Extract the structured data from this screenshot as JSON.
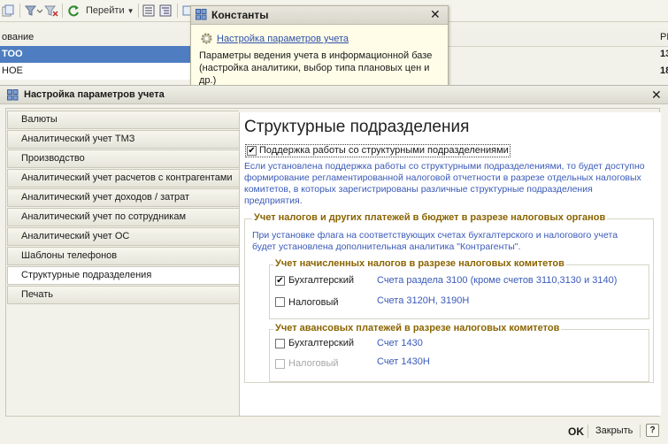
{
  "background": {
    "toolbar": {
      "goto_label": "Перейти"
    },
    "header": {
      "col_name": "ование",
      "col_right": "РЕ"
    },
    "rows": [
      {
        "name": "ТОО",
        "right": "13"
      },
      {
        "name": "НОЕ",
        "right": "18"
      }
    ]
  },
  "popup": {
    "title": "Константы",
    "link": "Настройка параметров учета",
    "description": "Параметры ведения учета в информационной базе (настройка аналитики, выбор типа плановых цен и др.)"
  },
  "window": {
    "title": "Настройка параметров учета",
    "tabs": [
      {
        "label": "Валюты"
      },
      {
        "label": "Аналитический учет ТМЗ"
      },
      {
        "label": "Производство"
      },
      {
        "label": "Аналитический учет расчетов с контрагентами"
      },
      {
        "label": "Аналитический учет доходов / затрат"
      },
      {
        "label": "Аналитический учет по сотрудникам"
      },
      {
        "label": "Аналитический учет ОС"
      },
      {
        "label": "Шаблоны телефонов"
      },
      {
        "label": "Структурные подразделения"
      },
      {
        "label": "Печать"
      }
    ],
    "content": {
      "heading": "Структурные подразделения",
      "support_checkbox": {
        "label": "Поддержка работы со структурными подразделениями",
        "checked": true
      },
      "support_description": "Если установлена поддержка работы со структурными подразделениями, то будет доступно формирование регламентированной налоговой отчетности в разрезе отдельных налоговых комитетов, в которых зарегистрированы различные структурные подразделения предприятия.",
      "budget_group": {
        "title": "Учет налогов и других платежей в бюджет в разрезе налоговых органов",
        "description": "При установке флага на соответствующих счетах бухгалтерского и налогового учета будет установлена дополнительная аналитика \"Контрагенты\".",
        "accrued": {
          "title": "Учет начисленных налогов в разрезе налоговых комитетов",
          "accounting": {
            "label": "Бухгалтерский",
            "checked": true,
            "accounts": "Счета раздела 3100 (кроме счетов 3110,3130 и 3140)"
          },
          "tax": {
            "label": "Налоговый",
            "checked": false,
            "accounts": "Счета 3120Н, 3190Н"
          }
        },
        "advance": {
          "title": "Учет авансовых платежей  в разрезе налоговых комитетов",
          "accounting": {
            "label": "Бухгалтерский",
            "checked": false,
            "accounts": "Счет 1430"
          },
          "tax": {
            "label": "Налоговый",
            "checked": false,
            "disabled": true,
            "accounts": "Счет 1430Н"
          }
        }
      }
    },
    "footer": {
      "ok": "OK",
      "close": "Закрыть",
      "help": "?"
    }
  },
  "colors": {
    "accent": "#2f51a8",
    "group_title": "#8a6400",
    "selected_row": "#4e7ec1"
  }
}
